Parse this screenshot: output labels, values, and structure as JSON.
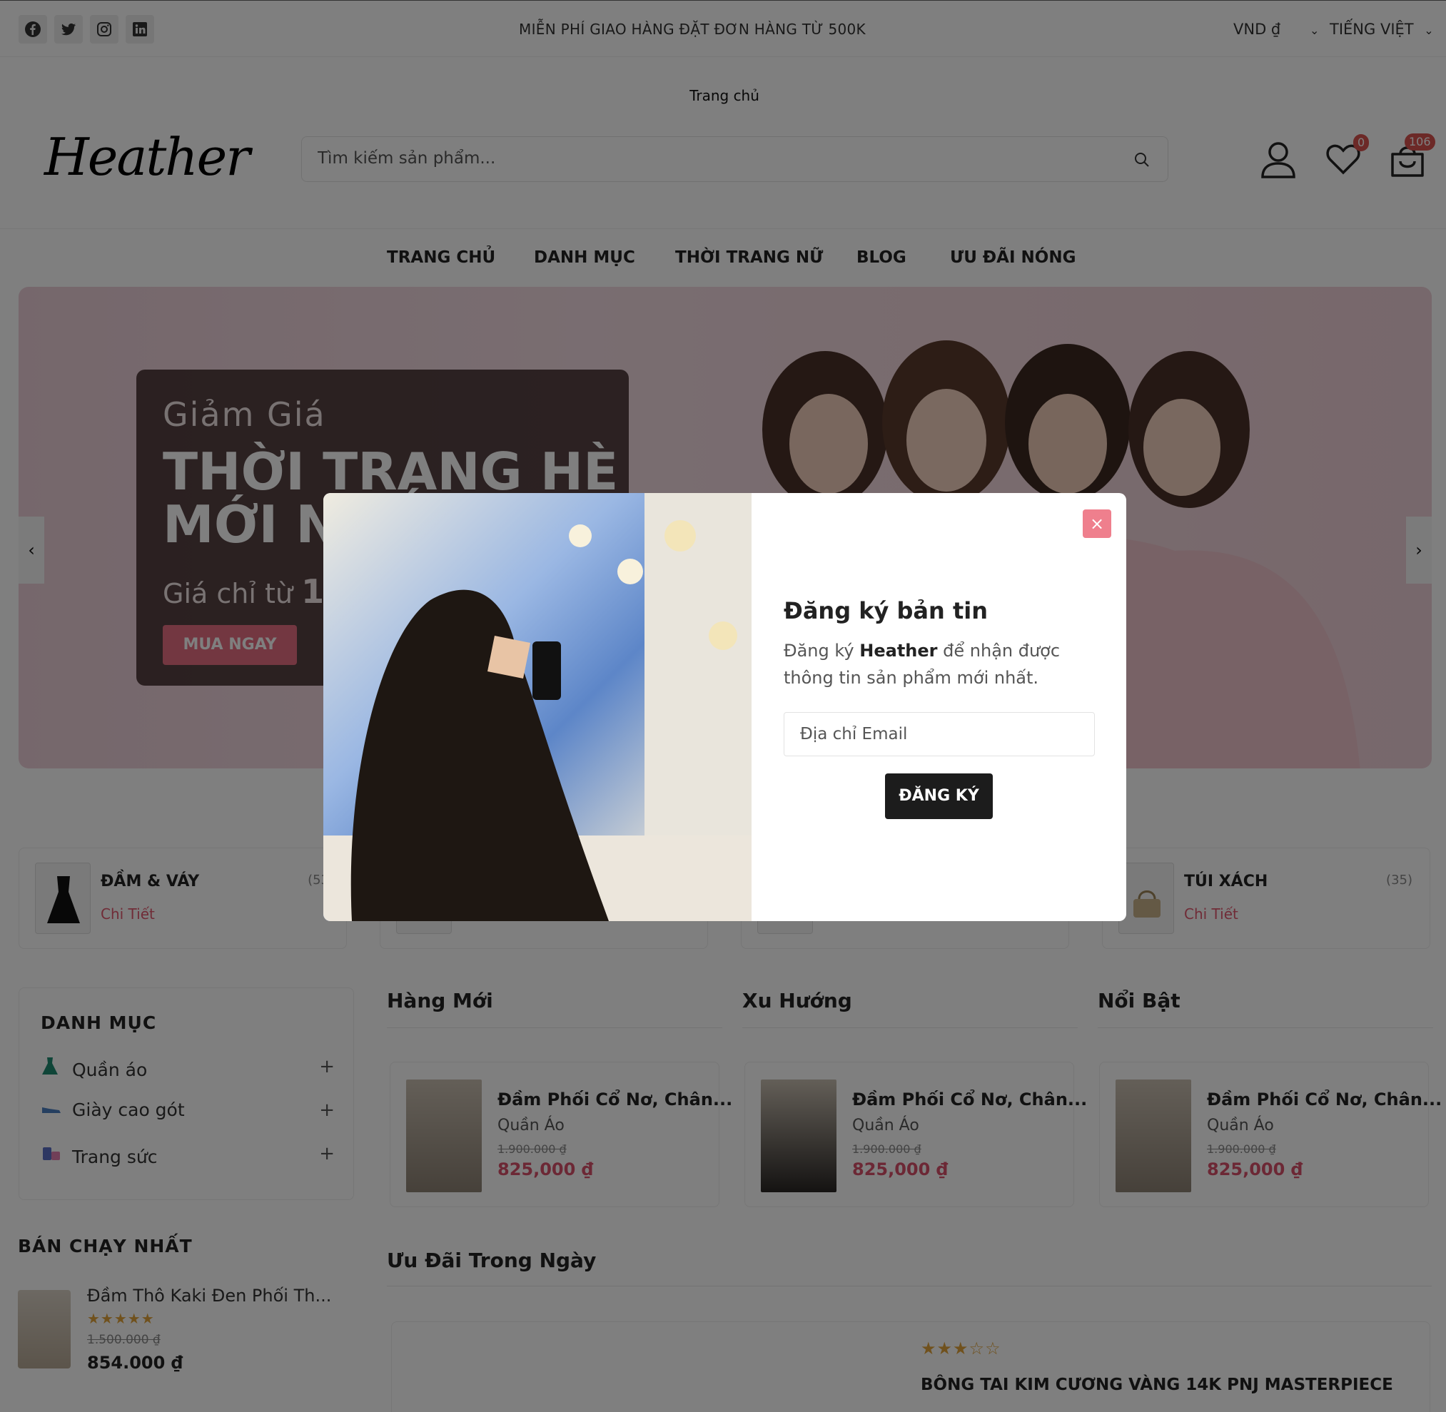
{
  "topbar": {
    "social": [
      "facebook-icon",
      "twitter-icon",
      "instagram-icon",
      "linkedin-icon"
    ],
    "promo": "MIỄN PHÍ GIAO HÀNG ĐẶT ĐƠN HÀNG TỪ 500K",
    "currency": "VND ₫",
    "language": "TIẾNG VIỆT"
  },
  "home_link": "Trang chủ",
  "header": {
    "logo": "Heather",
    "search_placeholder": "Tìm kiếm sản phẩm...",
    "wishlist_count": "0",
    "cart_count": "106"
  },
  "nav": [
    "TRANG CHỦ",
    "DANH MỤC",
    "THỜI TRANG NỮ",
    "BLOG",
    "ƯU ĐÃI NÓNG"
  ],
  "banner": {
    "subtitle": "Giảm Giá",
    "title": "THỜI TRANG HÈ MỚI NHẤT",
    "price_prefix": "Giá chỉ từ",
    "price_value": "10",
    "button": "MUA NGAY",
    "prev": "‹",
    "next": "›"
  },
  "categories": [
    {
      "name": "ĐẦM & VÁY",
      "count": "(53",
      "link": "Chi Tiết"
    },
    {
      "name": "TÚI XÁCH",
      "count": "(35)",
      "link": "Chi Tiết"
    }
  ],
  "sidebar": {
    "title": "DANH MỤC",
    "items": [
      {
        "label": "Quần áo",
        "icon": "dress-icon"
      },
      {
        "label": "Giày cao gót",
        "icon": "shoe-icon"
      },
      {
        "label": "Trang sức",
        "icon": "jewelry-icon"
      }
    ]
  },
  "bestseller": {
    "title": "BÁN CHẠY NHẤT",
    "name": "Đầm Thô Kaki Đen Phối Th...",
    "stars": "★★★★★",
    "old_price": "1.500.000 ₫",
    "price": "854.000 ₫"
  },
  "columns": [
    {
      "title": "Hàng Mới",
      "product": {
        "name": "Đầm Phối Cổ Nơ, Chân...",
        "category": "Quần Áo",
        "old_price": "1.900.000 ₫",
        "price": "825,000 ₫"
      }
    },
    {
      "title": "Xu Hướng",
      "product": {
        "name": "Đầm Phối Cổ Nơ, Chân...",
        "category": "Quần Áo",
        "old_price": "1.900.000 ₫",
        "price": "825,000 ₫"
      }
    },
    {
      "title": "Nổi Bật",
      "product": {
        "name": "Đầm Phối Cổ Nơ, Chân...",
        "category": "Quần Áo",
        "old_price": "1.900.000 ₫",
        "price": "825,000 ₫"
      }
    }
  ],
  "deal": {
    "title": "Ưu Đãi Trong Ngày",
    "stars": "★★★☆☆",
    "name": "BÔNG TAI KIM CƯƠNG VÀNG 14K PNJ MASTERPIECE"
  },
  "modal": {
    "close": "×",
    "title": "Đăng ký bản tin",
    "text_before": "Đăng ký",
    "brand": "Heather",
    "text_after": "để nhận được thông tin sản phẩm mới nhất.",
    "email_placeholder": "Địa chỉ Email",
    "button": "ĐĂNG KÝ"
  }
}
